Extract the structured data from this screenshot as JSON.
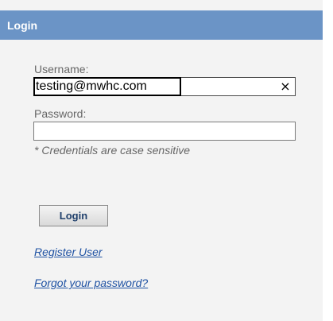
{
  "header": {
    "title": "Login"
  },
  "form": {
    "username_label": "Username:",
    "username_value": "testing@mwhc.com",
    "clear_glyph": "×",
    "password_label": "Password:",
    "password_value": "",
    "note": "* Credentials are case sensitive",
    "login_button": "Login"
  },
  "links": {
    "register": "Register User",
    "forgot": "Forgot your password?"
  },
  "colors": {
    "header_bg": "#6b94c6",
    "panel_bg": "#f3f3f3",
    "link": "#1f52a3"
  },
  "icons": {
    "clear": "close-icon"
  }
}
